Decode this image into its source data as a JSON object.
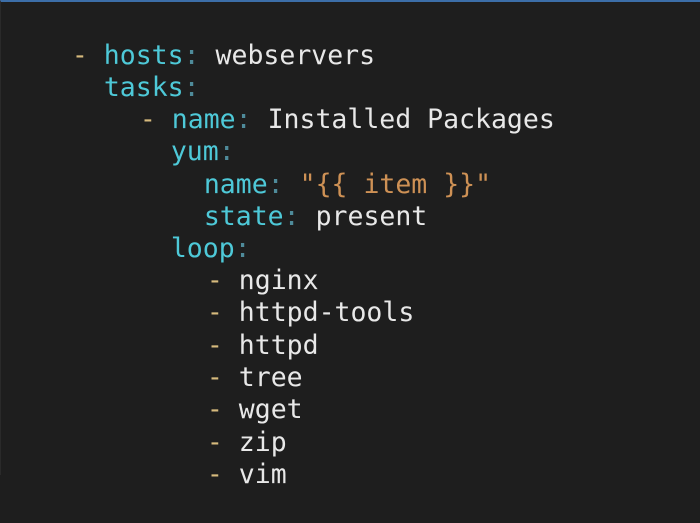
{
  "colors": {
    "background": "#1e1e1e",
    "dash": "#d7ba7d",
    "key": "#4ec9d8",
    "colon": "#4f8b9a",
    "plain_value": "#e8e8e8",
    "string_value": "#ce9155"
  },
  "code": {
    "hosts": {
      "dash": "-",
      "key": "hosts",
      "colon": ":",
      "value": "webservers"
    },
    "tasks": {
      "key": "tasks",
      "colon": ":"
    },
    "task_name": {
      "dash": "-",
      "key": "name",
      "colon": ":",
      "value": "Installed Packages"
    },
    "yum": {
      "key": "yum",
      "colon": ":"
    },
    "yum_name": {
      "key": "name",
      "colon": ":",
      "value": "\"{{ item }}\""
    },
    "yum_state": {
      "key": "state",
      "colon": ":",
      "value": "present"
    },
    "loop": {
      "key": "loop",
      "colon": ":"
    },
    "loop_items": [
      {
        "dash": "-",
        "value": "nginx"
      },
      {
        "dash": "-",
        "value": "httpd-tools"
      },
      {
        "dash": "-",
        "value": "httpd"
      },
      {
        "dash": "-",
        "value": "tree"
      },
      {
        "dash": "-",
        "value": "wget"
      },
      {
        "dash": "-",
        "value": "zip"
      },
      {
        "dash": "-",
        "value": "vim"
      }
    ]
  }
}
